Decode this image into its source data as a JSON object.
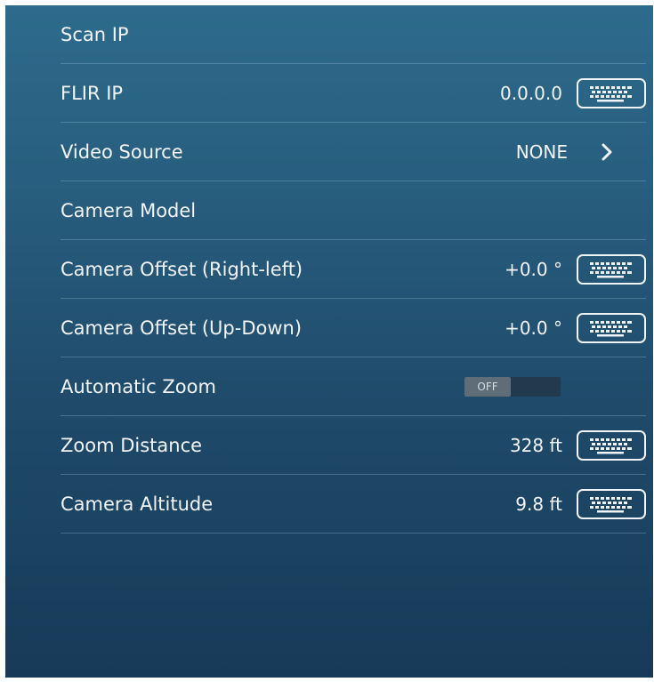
{
  "settings": {
    "rows": [
      {
        "label": "Scan IP"
      },
      {
        "label": "FLIR IP",
        "value": "0.0.0.0"
      },
      {
        "label": "Video Source",
        "value": "NONE"
      },
      {
        "label": "Camera Model"
      },
      {
        "label": "Camera Offset (Right-left)",
        "value": "+0.0 °"
      },
      {
        "label": "Camera Offset (Up-Down)",
        "value": "+0.0 °"
      },
      {
        "label": "Automatic Zoom",
        "toggle_label": "OFF"
      },
      {
        "label": "Zoom Distance",
        "value": "328 ft"
      },
      {
        "label": "Camera Altitude",
        "value": "9.8 ft"
      }
    ]
  },
  "icons": {
    "keyboard": "keyboard-icon",
    "chevron": "chevron-right-icon"
  },
  "colors": {
    "panel_top": "#2d6b8c",
    "panel_bottom": "#173a58",
    "text": "#f2f5f8"
  }
}
